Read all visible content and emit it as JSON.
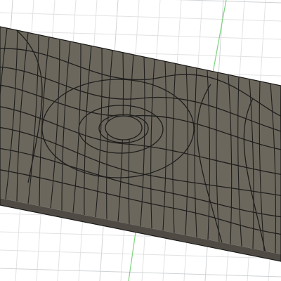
{
  "viewport": {
    "background_color": "#ffffff",
    "grid_minor_color": "#e2e2e2",
    "grid_major_color": "#cfd3d6",
    "y_axis_color": "#7fd27f"
  },
  "model": {
    "icon": "textured-plate-model",
    "top_face_color": "#6b675d",
    "side_face_color": "#4f4b44",
    "edge_color": "#1c1b1a",
    "groove_color": "#1f1e1c"
  }
}
